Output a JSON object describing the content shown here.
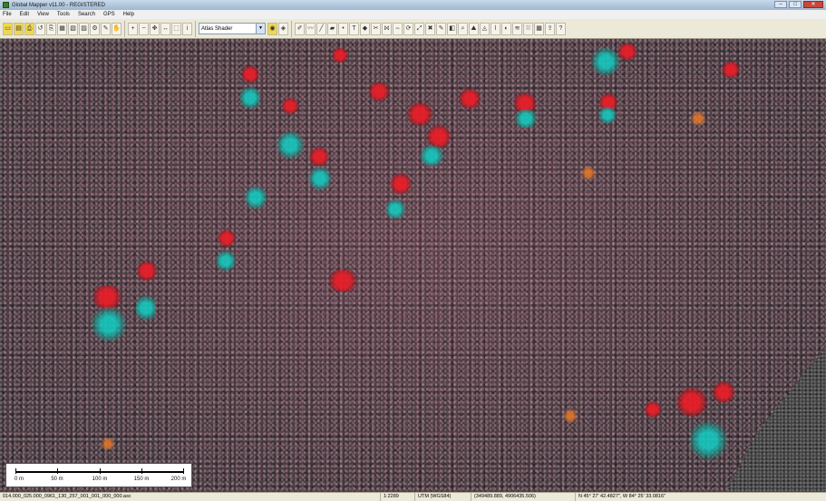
{
  "window": {
    "title": "Global Mapper v11.00 - REGISTERED",
    "controls": {
      "minimize": "–",
      "maximize": "□",
      "close": "✕"
    }
  },
  "menu": [
    "File",
    "Edit",
    "View",
    "Tools",
    "Search",
    "GPS",
    "Help"
  ],
  "toolbar": {
    "icons_group1": [
      "open-icon",
      "save-icon",
      "print-icon",
      "refresh-icon",
      "copy-icon",
      "map-icon",
      "overlay-icon",
      "layer-icon",
      "config-icon",
      "draw-icon",
      "hand-icon"
    ],
    "icons_group1_glyphs": [
      "▭",
      "▤",
      "⎙",
      "↺",
      "⎘",
      "▦",
      "▧",
      "▨",
      "⚙",
      "✎",
      "✋"
    ],
    "icons_group2": [
      "zoom-in-icon",
      "zoom-out-icon",
      "pan-icon",
      "measure-icon",
      "select-icon",
      "info-icon"
    ],
    "icons_group2_glyphs": [
      "+",
      "−",
      "✥",
      "↔",
      "⬚",
      "i"
    ],
    "shader_select": {
      "value": "Atlas Shader"
    },
    "icons_group3": [
      "palette-icon",
      "color-icon"
    ],
    "icons_group3_glyphs": [
      "◉",
      "◈"
    ],
    "icons_group4": [
      "digitize-icon",
      "path-icon",
      "line-icon",
      "area-icon",
      "point-icon",
      "text-icon",
      "vertex-icon",
      "split-icon",
      "join-icon",
      "move-icon",
      "rotate-icon",
      "scale-icon",
      "delete-icon",
      "edit-icon",
      "feature-icon",
      "search-icon",
      "terrain-icon",
      "3d-icon",
      "profile-icon",
      "view-icon",
      "contour-icon",
      "watershed-icon",
      "grid-icon",
      "export-icon",
      "help-icon"
    ],
    "icons_group4_glyphs": [
      "✐",
      "〰",
      "╱",
      "▰",
      "•",
      "T",
      "◆",
      "✂",
      "⨝",
      "⇔",
      "⟳",
      "⤢",
      "✖",
      "✎",
      "◧",
      "⌕",
      "⛰",
      "◬",
      "⌇",
      "◐",
      "≋",
      "⛆",
      "▦",
      "⇪",
      "?"
    ]
  },
  "map": {
    "colors": {
      "canopy": "#4a3a40",
      "red_class": "#e61e28",
      "cyan_class": "#14c8be",
      "orange_class": "#e67828"
    }
  },
  "scalebar": {
    "labels": [
      "0 m",
      "50 m",
      "100 m",
      "150 m",
      "200 m"
    ]
  },
  "statusbar": {
    "file": "014.000_025.000_0961_130_257_001_001_000_000.asc",
    "scale": "1:2289",
    "projection": "UTM (WGS84)",
    "coords": "(349489.889, 4906435.506)",
    "latlon": "N 45° 27' 42.4827\", W 84° 25' 33.0816\""
  }
}
